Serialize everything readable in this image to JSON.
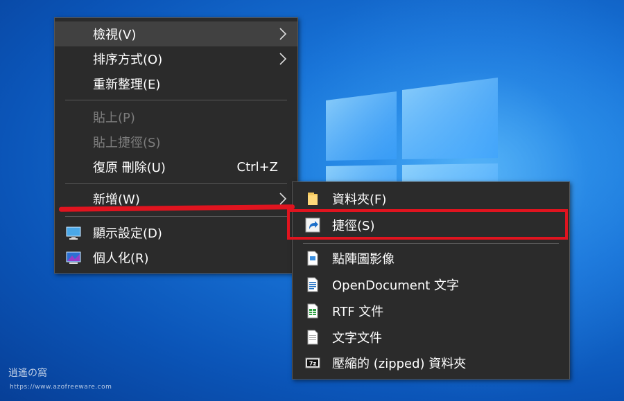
{
  "context_menu": {
    "items": [
      {
        "label": "檢視(V)",
        "submenu": true
      },
      {
        "label": "排序方式(O)",
        "submenu": true
      },
      {
        "label": "重新整理(E)"
      },
      {
        "label": "貼上(P)",
        "disabled": true
      },
      {
        "label": "貼上捷徑(S)",
        "disabled": true
      },
      {
        "label": "復原 刪除(U)",
        "shortcut": "Ctrl+Z"
      },
      {
        "label": "新增(W)",
        "submenu": true
      },
      {
        "label": "顯示設定(D)",
        "icon": "display-settings-icon"
      },
      {
        "label": "個人化(R)",
        "icon": "personalize-icon"
      }
    ]
  },
  "new_submenu": {
    "items": [
      {
        "label": "資料夾(F)",
        "icon": "folder-icon"
      },
      {
        "label": "捷徑(S)",
        "icon": "shortcut-icon"
      },
      {
        "label": "點陣圖影像",
        "icon": "bitmap-icon"
      },
      {
        "label": "OpenDocument 文字",
        "icon": "odt-document-icon"
      },
      {
        "label": "RTF 文件",
        "icon": "rtf-document-icon"
      },
      {
        "label": "文字文件",
        "icon": "text-document-icon"
      },
      {
        "label": "壓縮的 (zipped) 資料夾",
        "icon": "7z-archive-icon"
      }
    ]
  },
  "colors": {
    "menu_bg": "#2b2b2b",
    "highlight": "#e0141f",
    "desktop": "#0b55b8"
  },
  "watermark": {
    "text": "逍遙の窩",
    "url": "https://www.azofreeware.com"
  }
}
